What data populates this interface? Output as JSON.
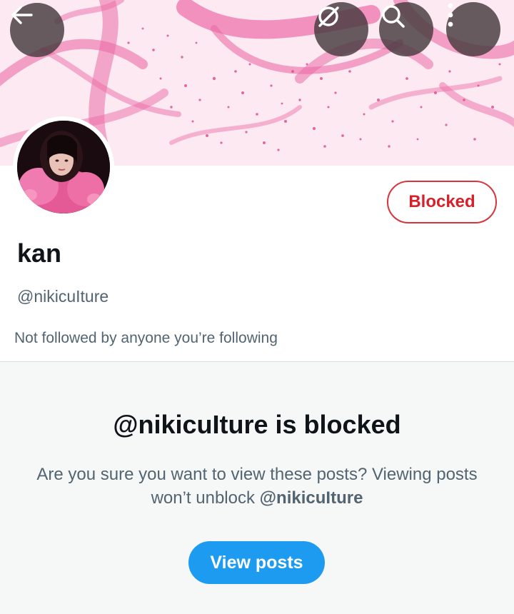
{
  "header": {
    "back_icon": "arrow-left-icon",
    "grok_icon": "grok-icon",
    "search_icon": "search-icon",
    "more_icon": "more-vertical-icon"
  },
  "profile": {
    "display_name": "kan",
    "handle": "@nikicuIture",
    "followed_by": "Not followed by anyone you’re following",
    "blocked_button_label": "Blocked"
  },
  "blocked_notice": {
    "title": "@nikicuIture is blocked",
    "message_prefix": "Are you sure you want to view these posts? Viewing posts won’t unblock ",
    "message_handle": "@nikicuIture",
    "view_button_label": "View posts"
  },
  "colors": {
    "blocked_red": "#d8202a",
    "primary_blue": "#1d9bf0",
    "secondary_text": "#536471",
    "banner_pink": "#e9559a"
  }
}
